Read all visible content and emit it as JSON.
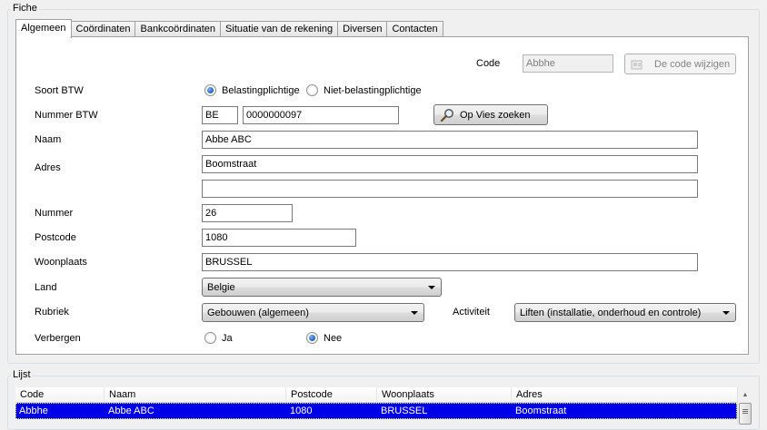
{
  "fiche": {
    "title": "Fiche",
    "tabs": [
      "Algemeen",
      "Coördinaten",
      "Bankcoördinaten",
      "Situatie van de rekening",
      "Diversen",
      "Contacten"
    ],
    "active_tab": "Algemeen"
  },
  "form": {
    "code_label": "Code",
    "code_value": "Abbhe",
    "change_code_button": "De code wijzigen",
    "soort_btw_label": "Soort BTW",
    "soort_btw_options": [
      "Belastingplichtige",
      "Niet-belastingplichtige"
    ],
    "soort_btw_selected": "Belastingplichtige",
    "nummer_btw_label": "Nummer BTW",
    "btw_country": "BE",
    "btw_number": "0000000097",
    "vies_button": "Op Vies zoeken",
    "naam_label": "Naam",
    "naam_value": "Abbe ABC",
    "adres_label": "Adres",
    "adres_line1": "Boomstraat",
    "adres_line2": "",
    "nummer_label": "Nummer",
    "nummer_value": "26",
    "postcode_label": "Postcode",
    "postcode_value": "1080",
    "woonplaats_label": "Woonplaats",
    "woonplaats_value": "BRUSSEL",
    "land_label": "Land",
    "land_value": "Belgie",
    "rubriek_label": "Rubriek",
    "rubriek_value": "Gebouwen (algemeen)",
    "activiteit_label": "Activiteit",
    "activiteit_value": "Liften (installatie, onderhoud en controle)",
    "verbergen_label": "Verbergen",
    "verbergen_options": [
      "Ja",
      "Nee"
    ],
    "verbergen_selected": "Nee"
  },
  "lijst": {
    "title": "Lijst",
    "columns": [
      "Code",
      "Naam",
      "Postcode",
      "Woonplaats",
      "Adres"
    ],
    "rows": [
      {
        "code": "Abbhe",
        "naam": "Abbe ABC",
        "postcode": "1080",
        "woonplaats": "BRUSSEL",
        "adres": "Boomstraat"
      }
    ]
  },
  "icons": {
    "change_code": "user-card-icon",
    "vies": "magnifier-icon"
  },
  "colors": {
    "selection": "#0000e8",
    "panel_border": "#a0a0a0"
  }
}
